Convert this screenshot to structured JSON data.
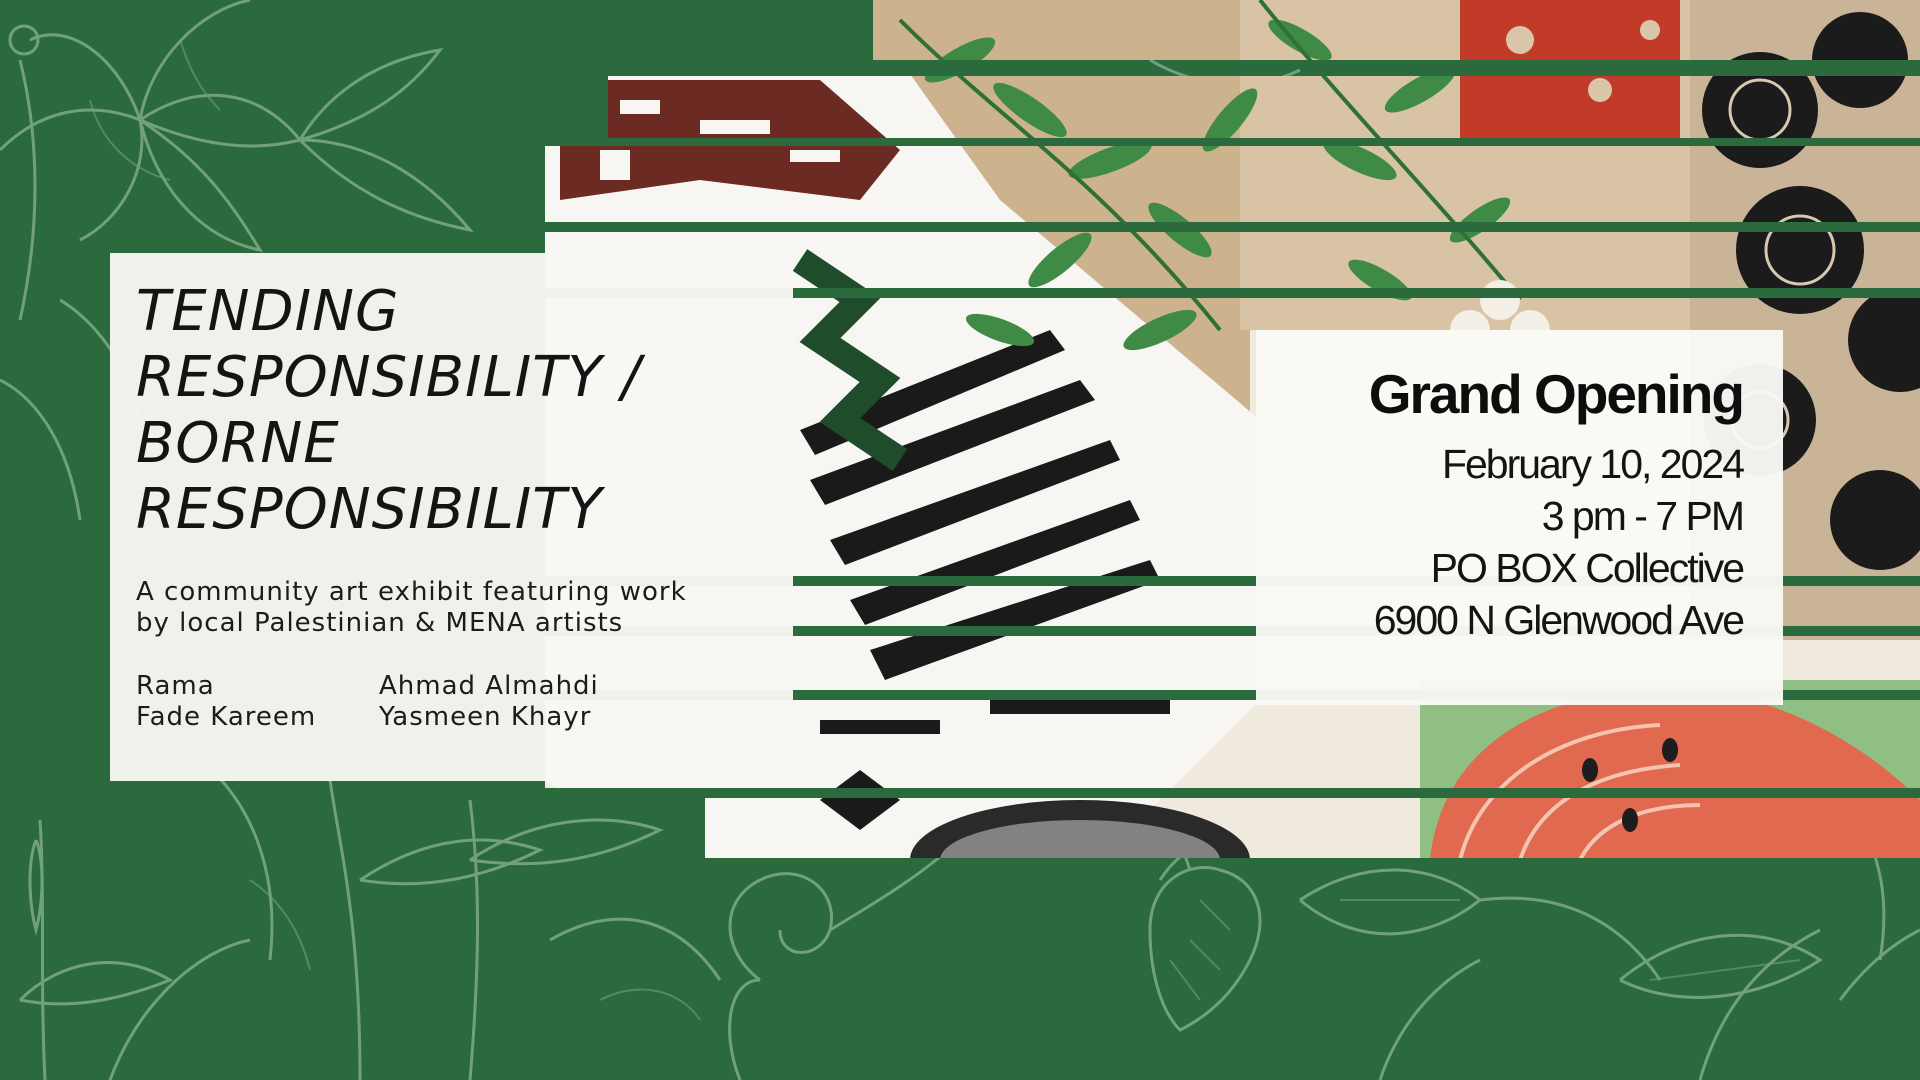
{
  "colors": {
    "background": "#2b6a3c",
    "botanical_line": "#7faa88",
    "card": "#f8f7f3",
    "text": "#141414"
  },
  "collage": {
    "icons": [
      "linocut-prints",
      "leaf-print",
      "watermelon-print",
      "flower-print",
      "calligraphy-print"
    ]
  },
  "exhibit": {
    "title_lines": [
      "TENDING",
      "RESPONSIBILITY /",
      "BORNE",
      "RESPONSIBILITY"
    ],
    "description_lines": [
      "A community art exhibit featuring work",
      "by local Palestinian & MENA artists"
    ],
    "artists": [
      "Rama",
      "Ahmad Almahdi",
      "Fade Kareem",
      "Yasmeen Khayr"
    ]
  },
  "event": {
    "heading": "Grand Opening",
    "date": "February 10, 2024",
    "time": "3 pm - 7 PM",
    "venue": "PO BOX Collective",
    "address": "6900 N Glenwood Ave"
  }
}
